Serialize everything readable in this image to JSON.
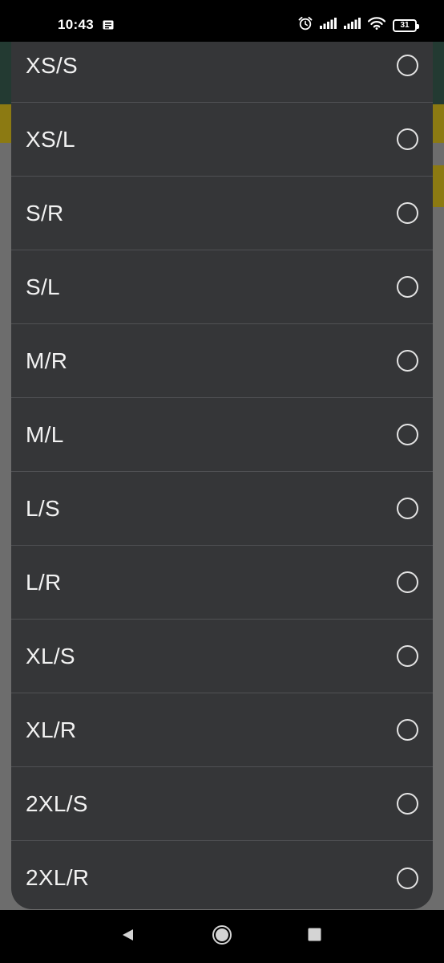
{
  "status_bar": {
    "time": "10:43",
    "battery": "31",
    "icons": [
      "notification-icon",
      "alarm-icon",
      "signal-icon",
      "signal-icon",
      "wifi-icon",
      "battery-icon"
    ]
  },
  "sheet": {
    "options": [
      {
        "label": "XS/S",
        "selected": false
      },
      {
        "label": "XS/L",
        "selected": false
      },
      {
        "label": "S/R",
        "selected": false
      },
      {
        "label": "S/L",
        "selected": false
      },
      {
        "label": "M/R",
        "selected": false
      },
      {
        "label": "M/L",
        "selected": false
      },
      {
        "label": "L/S",
        "selected": false
      },
      {
        "label": "L/R",
        "selected": false
      },
      {
        "label": "XL/S",
        "selected": false
      },
      {
        "label": "XL/R",
        "selected": false
      },
      {
        "label": "2XL/S",
        "selected": false
      },
      {
        "label": "2XL/R",
        "selected": false
      }
    ]
  },
  "nav_bar": {
    "icons": [
      "back-icon",
      "home-icon",
      "recents-icon"
    ]
  },
  "colors": {
    "sheet_background": "#353638",
    "divider": "#505154",
    "option_text": "#f2f2f2",
    "radio_border": "#e3e3e3",
    "scrim": "#6d6d6d"
  }
}
